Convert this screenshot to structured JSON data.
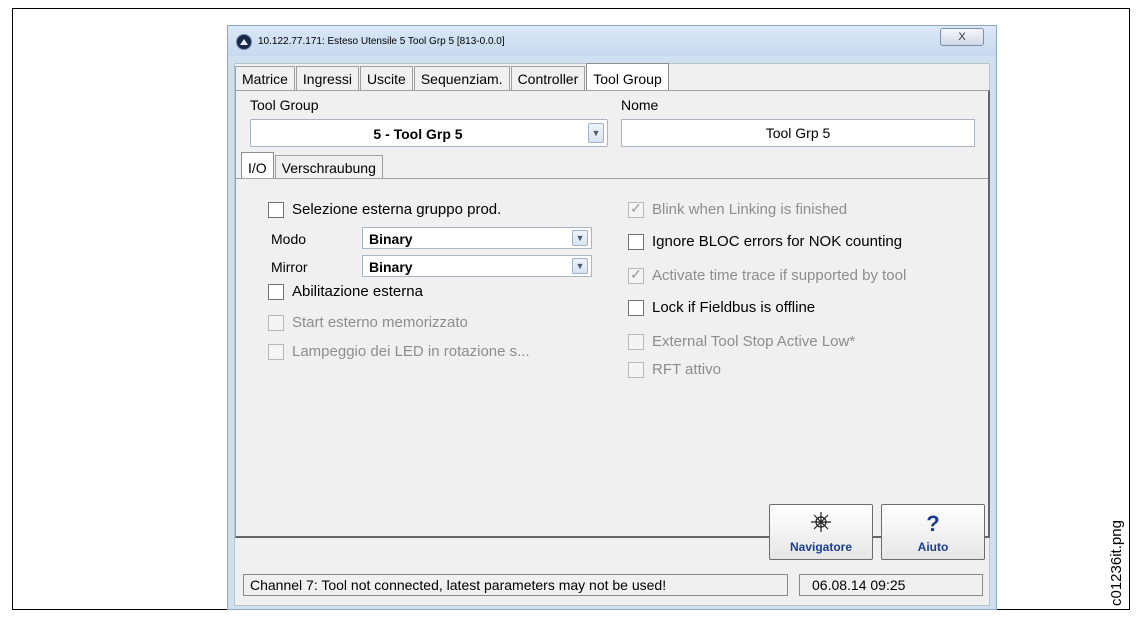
{
  "window": {
    "title": "10.122.77.171: Esteso  Utensile 5  Tool Grp 5 [813-0.0.0]",
    "close_symbol": "X"
  },
  "main_tabs": [
    "Matrice",
    "Ingressi",
    "Uscite",
    "Sequenziam.",
    "Controller",
    "Tool Group"
  ],
  "active_main_tab": "Tool Group",
  "tool_group": {
    "label": "Tool Group",
    "selected": "5 - Tool Grp 5",
    "name_label": "Nome",
    "name_value": "Tool Grp 5"
  },
  "sub_tabs": [
    "I/O",
    "Verschraubung"
  ],
  "active_sub_tab": "I/O",
  "io_left": {
    "ext_group_sel": {
      "label": "Selezione esterna gruppo prod.",
      "checked": false,
      "enabled": true
    },
    "modo": {
      "label": "Modo",
      "value": "Binary"
    },
    "mirror": {
      "label": "Mirror",
      "value": "Binary"
    },
    "ext_enable": {
      "label": "Abilitazione esterna",
      "checked": false,
      "enabled": true
    },
    "ext_start": {
      "label": "Start esterno memorizzato",
      "checked": false,
      "enabled": false
    },
    "led_blink": {
      "label": "Lampeggio dei LED in rotazione s...",
      "checked": false,
      "enabled": false
    }
  },
  "io_right": {
    "blink_link": {
      "label": "Blink when Linking is finished",
      "checked": true,
      "enabled": false
    },
    "ignore_bloc": {
      "label": "Ignore BLOC errors for NOK counting",
      "checked": false,
      "enabled": true
    },
    "time_trace": {
      "label": "Activate time trace if supported by tool",
      "checked": true,
      "enabled": false
    },
    "lock_fieldbus": {
      "label": "Lock if Fieldbus is offline",
      "checked": false,
      "enabled": true
    },
    "ext_tool_stop": {
      "label": "External Tool Stop Active Low*",
      "checked": false,
      "enabled": false
    },
    "rft": {
      "label": "RFT attivo",
      "checked": false,
      "enabled": false
    }
  },
  "buttons": {
    "navigator": "Navigatore",
    "help": "Aiuto"
  },
  "status": {
    "message": "Channel 7: Tool not connected, latest parameters may not be used!",
    "datetime": "06.08.14 09:25"
  },
  "figure_label": "c01236it.png"
}
